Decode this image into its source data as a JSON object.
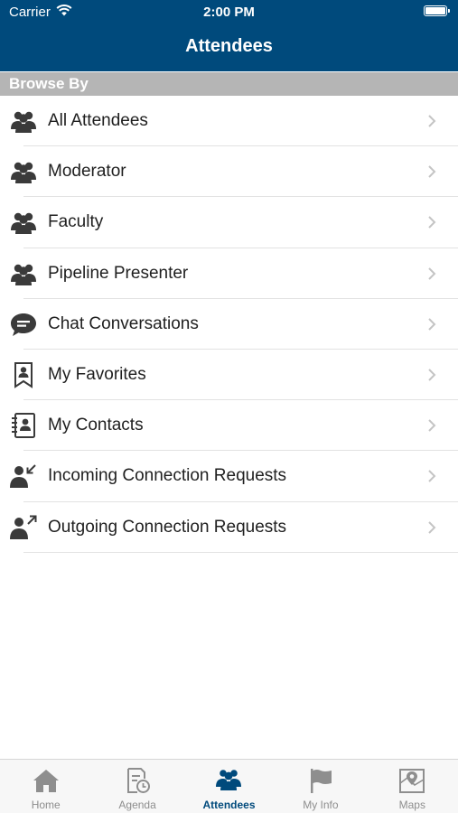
{
  "status_bar": {
    "carrier": "Carrier",
    "time": "2:00 PM"
  },
  "nav": {
    "title": "Attendees"
  },
  "section": {
    "title": "Browse By"
  },
  "list": {
    "items": [
      {
        "label": "All Attendees",
        "icon": "people-icon"
      },
      {
        "label": "Moderator",
        "icon": "people-icon"
      },
      {
        "label": "Faculty",
        "icon": "people-icon"
      },
      {
        "label": "Pipeline Presenter",
        "icon": "people-icon"
      },
      {
        "label": "Chat Conversations",
        "icon": "chat-bubble-icon"
      },
      {
        "label": "My Favorites",
        "icon": "bookmark-person-icon"
      },
      {
        "label": "My Contacts",
        "icon": "address-book-icon"
      },
      {
        "label": "Incoming Connection Requests",
        "icon": "person-incoming-icon"
      },
      {
        "label": "Outgoing Connection Requests",
        "icon": "person-outgoing-icon"
      }
    ]
  },
  "tabs": [
    {
      "label": "Home",
      "icon": "home-icon",
      "active": false
    },
    {
      "label": "Agenda",
      "icon": "agenda-icon",
      "active": false
    },
    {
      "label": "Attendees",
      "icon": "attendees-icon",
      "active": true
    },
    {
      "label": "My Info",
      "icon": "flag-icon",
      "active": false
    },
    {
      "label": "Maps",
      "icon": "map-icon",
      "active": false
    }
  ],
  "colors": {
    "header_bg": "#004a7c",
    "section_bg": "#b5b5b5",
    "icon_color": "#3a3a3a",
    "tab_active": "#004a7c",
    "tab_inactive": "#8e8e8e"
  }
}
